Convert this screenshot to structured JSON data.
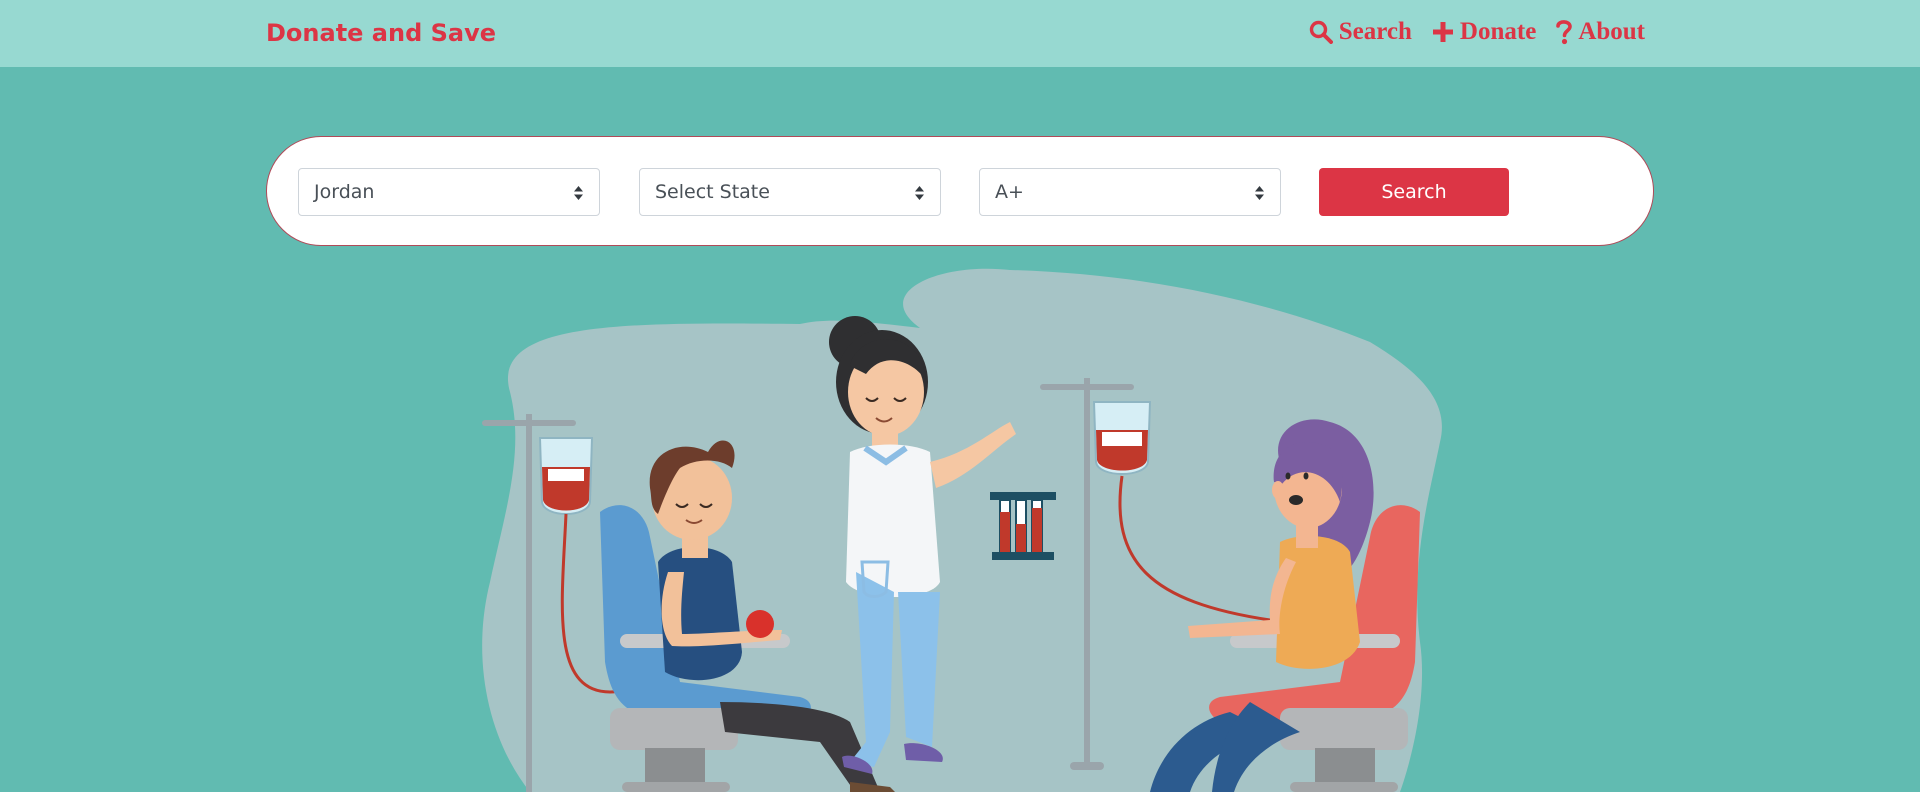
{
  "navbar": {
    "brand": "Donate and Save",
    "links": [
      {
        "label": "Search",
        "icon": "search-icon"
      },
      {
        "label": "Donate",
        "icon": "plus-icon"
      },
      {
        "label": "About",
        "icon": "question-icon"
      }
    ]
  },
  "search_form": {
    "country_selected": "Jordan",
    "state_selected": "Select State",
    "blood_type_selected": "A+",
    "submit_label": "Search"
  },
  "colors": {
    "accent": "#dc3545",
    "navbar_bg": "#97d9d1",
    "page_bg": "#61bbb1",
    "blob": "#a6c4c6"
  }
}
